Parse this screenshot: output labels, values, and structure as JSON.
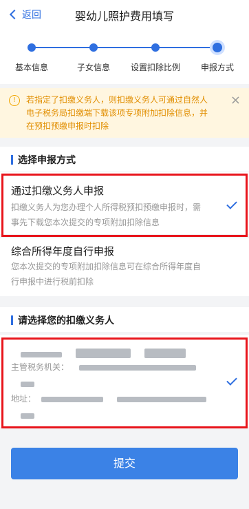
{
  "header": {
    "back_label": "返回",
    "title": "婴幼儿照护费用填写"
  },
  "steps": [
    "基本信息",
    "子女信息",
    "设置扣除比例",
    "申报方式"
  ],
  "notice": {
    "text": "若指定了扣缴义务人，则扣缴义务人可通过自然人电子税务局扣缴端下载该项专项附加扣除信息，并在预扣预缴申报时扣除",
    "warn_icon": "!",
    "close_icon": "×"
  },
  "method": {
    "section_label": "选择申报方式",
    "options": [
      {
        "name": "通过扣缴义务人申报",
        "desc": "扣缴义务人为您办理个人所得税预扣预缴申报时，需事先下载您本次提交的专项附加扣除信息",
        "selected": true
      },
      {
        "name": "综合所得年度自行申报",
        "desc": "您本次提交的专项附加扣除信息可在综合所得年度自行申报中进行税前扣除",
        "selected": false
      }
    ]
  },
  "agent": {
    "section_label": "请选择您的扣缴义务人",
    "authority_label": "主管税务机关：",
    "address_label": "地址："
  },
  "submit_label": "提交",
  "colors": {
    "accent": "#2f6fe0",
    "highlight": "#e8141b",
    "notice_text": "#e18e00"
  }
}
